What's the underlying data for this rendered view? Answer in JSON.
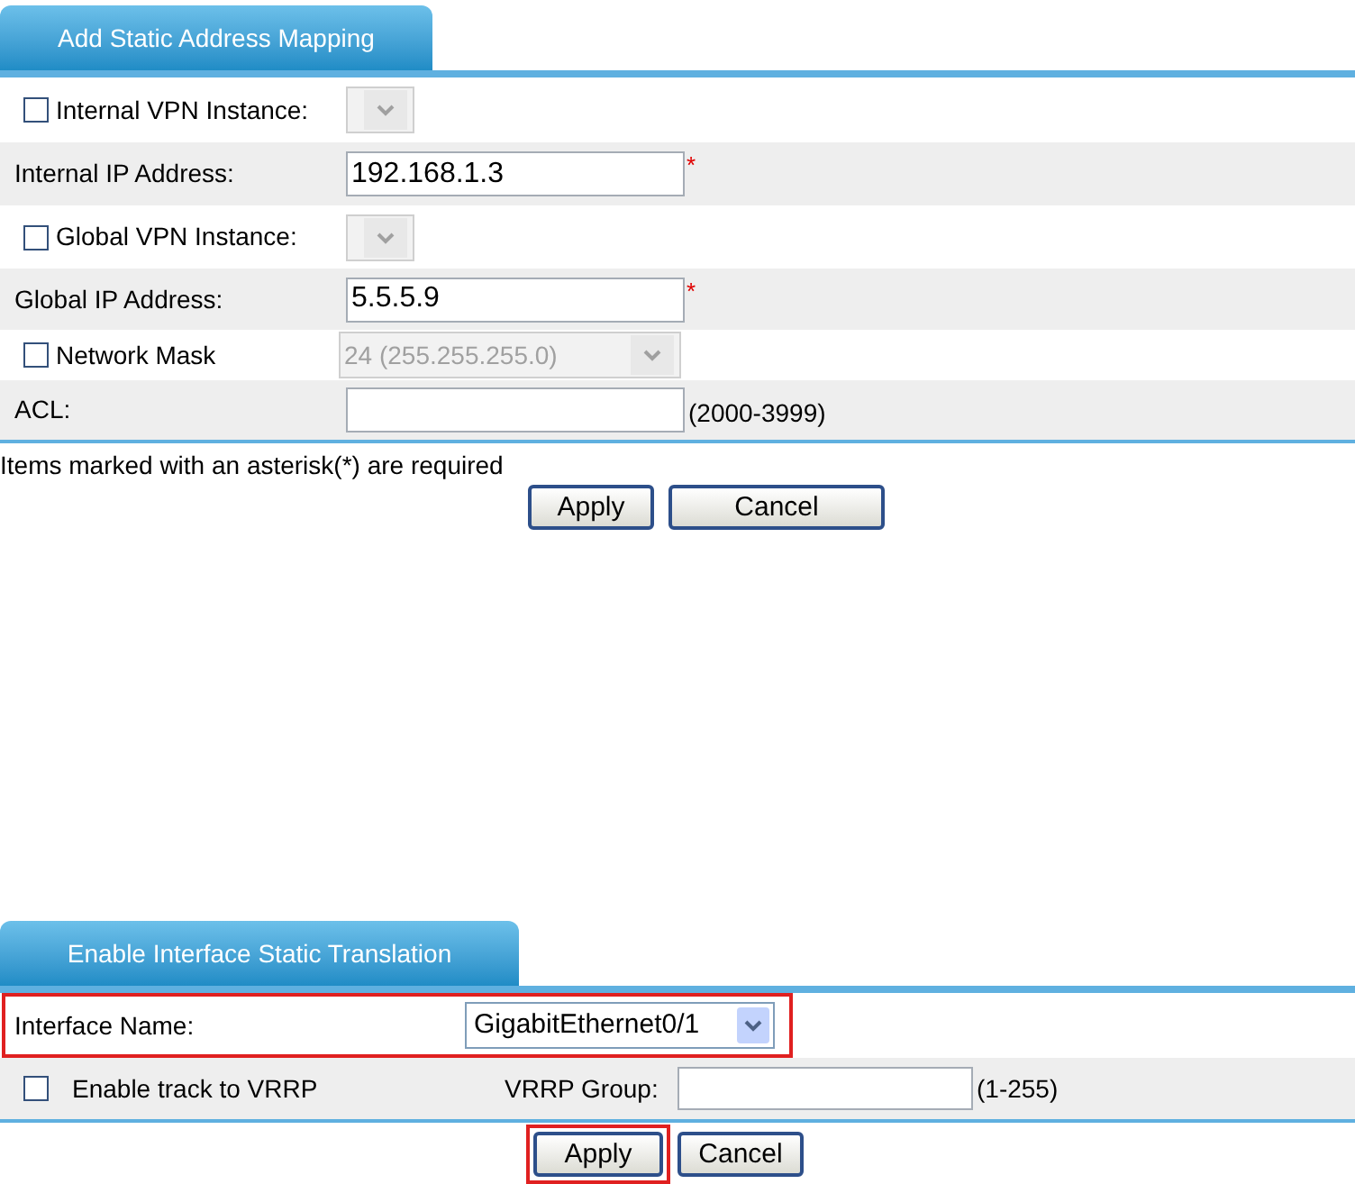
{
  "mapping_panel": {
    "tab": {
      "label": "Add Static Address Mapping",
      "selected": true
    },
    "rows": [
      {
        "kind": "check_select",
        "label": "Internal VPN Instance:",
        "checked": false,
        "disabled": true
      },
      {
        "kind": "field",
        "label": "Internal IP Address:",
        "value": "192.168.1.3",
        "required_mark": "*"
      },
      {
        "kind": "check_select",
        "label": "Global VPN Instance:",
        "checked": false,
        "disabled": true
      },
      {
        "kind": "field",
        "label": "Global IP Address:",
        "value": "5.5.5.9",
        "required_mark": "*"
      },
      {
        "kind": "check_select",
        "label": "Network Mask",
        "checked": false,
        "disabled": true,
        "value": "24 (255.255.255.0)"
      },
      {
        "kind": "field",
        "label": "ACL:",
        "hint": "(2000-3999)"
      }
    ],
    "note": "Items marked with an asterisk(*) are required",
    "buttons": [
      {
        "label": "Apply",
        "highlighted": false
      },
      {
        "label": "Cancel",
        "highlighted": false
      }
    ]
  },
  "interface_panel": {
    "tab": {
      "label": "Enable Interface Static Translation",
      "selected": true
    },
    "interface_row": {
      "label": "Interface Name:",
      "value": "GigabitEthernet0/1",
      "highlighted": true
    },
    "vrrp_row": {
      "checkbox_label": "Enable track to VRRP",
      "checked": false,
      "group_label": "VRRP Group:",
      "hint": "(1-255)"
    },
    "buttons": [
      {
        "label": "Apply",
        "highlighted": true
      },
      {
        "label": "Cancel",
        "highlighted": false
      }
    ]
  }
}
